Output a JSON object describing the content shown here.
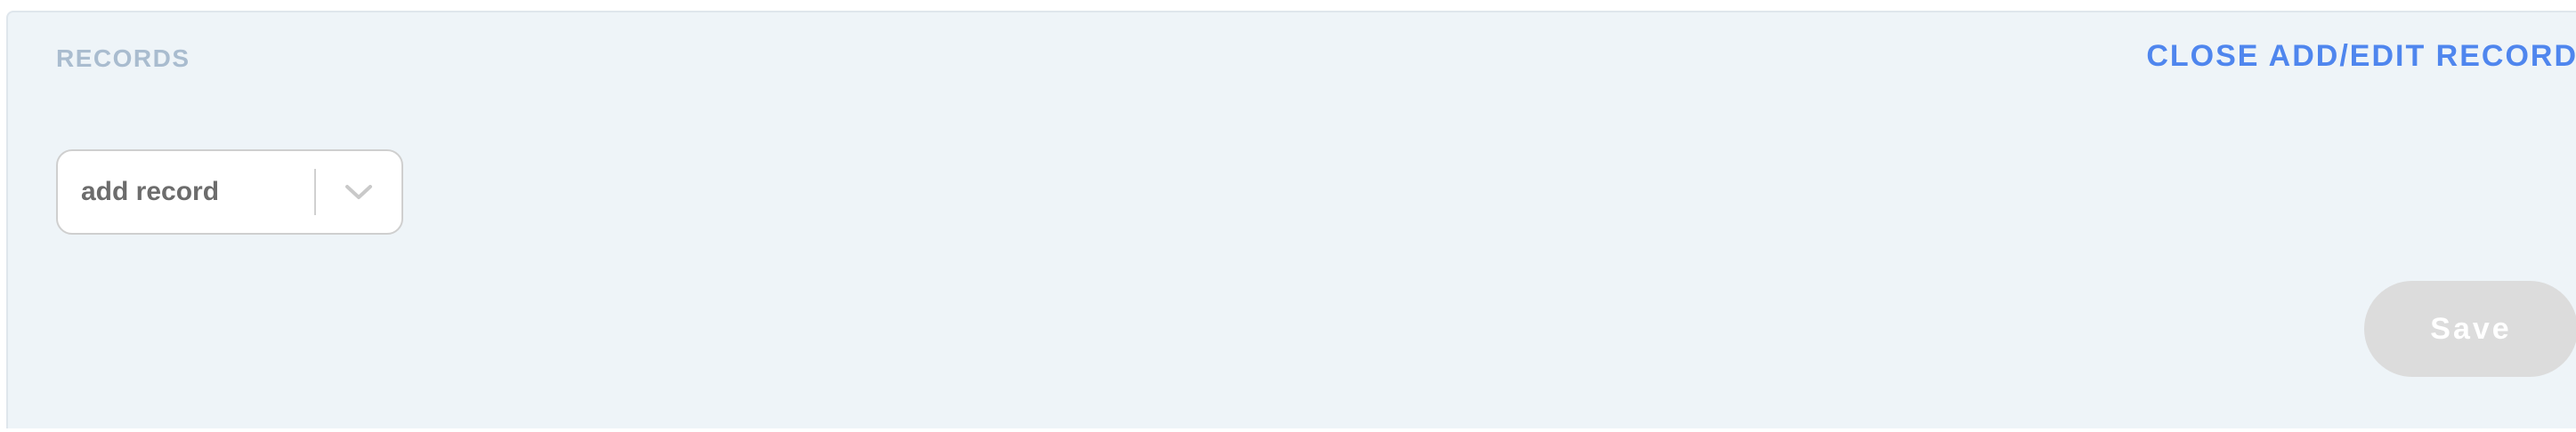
{
  "records_panel": {
    "title": "RECORDS",
    "close_link_label": "CLOSE ADD/EDIT RECORD",
    "record_select": {
      "selected_value": "add record",
      "toggle_icon": "chevron-down-icon"
    },
    "save_label": "Save"
  },
  "colors": {
    "panel_background": "#eef4f8",
    "title_text": "#a9bccf",
    "link_accent": "#4f86ee",
    "save_disabled_background": "#dcdcdc"
  }
}
